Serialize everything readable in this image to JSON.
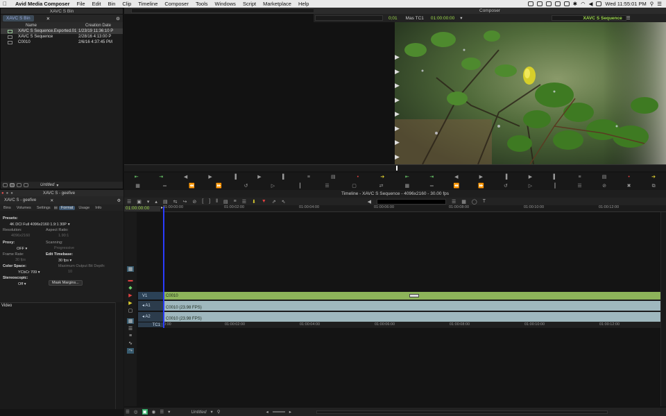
{
  "menubar": {
    "app_name": "Avid Media Composer",
    "items": [
      "File",
      "Edit",
      "Bin",
      "Clip",
      "Timeline",
      "Composer",
      "Tools",
      "Windows",
      "Script",
      "Marketplace",
      "Help"
    ],
    "clock": "Wed 11:55:01 PM"
  },
  "bin": {
    "title": "XAVC S Bin",
    "tab_label": "XAVC S Bin",
    "col_name": "Name",
    "col_date": "Creation Date",
    "items": [
      {
        "name": "XAVC S Sequence.Exported.01",
        "date": "1/23/19 11:36:10 P"
      },
      {
        "name": "XAVC S Sequence",
        "date": "2/28/16 4:13:00 P"
      },
      {
        "name": "C0010",
        "date": "2/6/16 4:37:45 PM"
      }
    ],
    "footer_label": "Untitled"
  },
  "composer": {
    "title": "Composer",
    "tc_a": "0;01",
    "tc_mode": "Mas  TC1",
    "tc_b": "01:00:00:00",
    "sequence_name": "XAVC S Sequence"
  },
  "settings": {
    "window_title": "XAVC S - geefive",
    "tab_title": "XAVC S - geefive",
    "tabs": [
      "Bins",
      "Volumes",
      "Settings",
      "Format",
      "Usage",
      "Info"
    ],
    "active_tab": "Format",
    "presets_label": "Presets:",
    "presets_value": "4K DCI Full 4096x2160 1.9:1 30P",
    "resolution_label": "Resolution:",
    "resolution_value": "4096x2160",
    "aspect_label": "Aspect Ratio:",
    "aspect_value": "1.90:1",
    "proxy_label": "Proxy:",
    "proxy_value": "OFF",
    "scanning_label": "Scanning:",
    "scanning_value": "Progressive",
    "frame_rate_label": "Frame Rate:",
    "frame_rate_value": "30 fps",
    "edit_timebase_label": "Edit Timebase:",
    "edit_timebase_value": "30 fps",
    "color_space_label": "Color Space:",
    "color_space_value": "YCbCr 709",
    "max_depth_label": "Maximum Output Bit Depth:",
    "max_depth_value": "10",
    "stereo_label": "Stereoscopic:",
    "stereo_value": "Off",
    "mask_button": "Mask Margins...",
    "video_label": "Video"
  },
  "timeline": {
    "title": "Timeline - XAVC S Sequence - 4096x2160 - 30.00 fps",
    "current_tc": "01:00:00:00",
    "ruler": [
      "01:00:00:00",
      "01:00:02:00",
      "01:00:04:00",
      "01:00:06:00",
      "01:00:08:00",
      "01:00:10:00",
      "01:00:12:00"
    ],
    "ruler_short": [
      "0:00",
      "01:00:02:00",
      "01:00:04:00",
      "01:00:06:00",
      "01:00:08:00",
      "01:00:10:00",
      "01:00:12:00"
    ],
    "tracks": [
      {
        "name": "V1",
        "clip": "C0010"
      },
      {
        "name": "A1",
        "clip": "C0010 (23.98 FPS)"
      },
      {
        "name": "A2",
        "clip": "C0010 (23.98 FPS)"
      },
      {
        "name": "TC1",
        "clip": ""
      }
    ],
    "footer_label": "Untitled"
  },
  "colors": {
    "video_track": "#8db45a",
    "audio_track": "#9fb8be",
    "playhead": "#2a3cff",
    "timecode_green": "#9fdc4c"
  }
}
